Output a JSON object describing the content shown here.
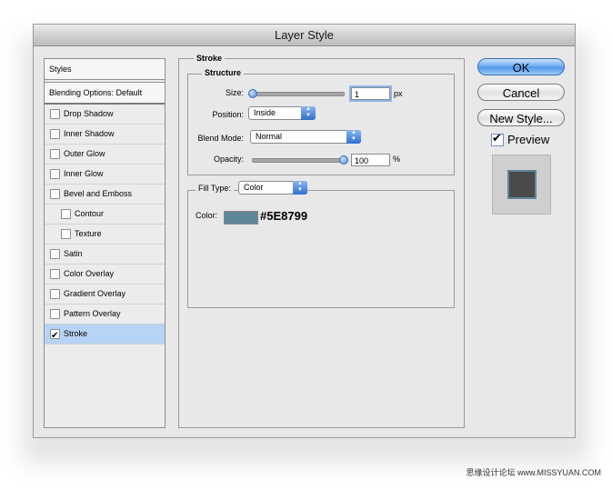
{
  "window": {
    "title": "Layer Style"
  },
  "left_panel": {
    "styles_header": "Styles",
    "blending_options": "Blending Options: Default",
    "items": [
      {
        "label": "Drop Shadow",
        "checked": false,
        "sub": false
      },
      {
        "label": "Inner Shadow",
        "checked": false,
        "sub": false
      },
      {
        "label": "Outer Glow",
        "checked": false,
        "sub": false
      },
      {
        "label": "Inner Glow",
        "checked": false,
        "sub": false
      },
      {
        "label": "Bevel and Emboss",
        "checked": false,
        "sub": false
      },
      {
        "label": "Contour",
        "checked": false,
        "sub": true
      },
      {
        "label": "Texture",
        "checked": false,
        "sub": true
      },
      {
        "label": "Satin",
        "checked": false,
        "sub": false
      },
      {
        "label": "Color Overlay",
        "checked": false,
        "sub": false
      },
      {
        "label": "Gradient Overlay",
        "checked": false,
        "sub": false
      },
      {
        "label": "Pattern Overlay",
        "checked": false,
        "sub": false
      },
      {
        "label": "Stroke",
        "checked": true,
        "sub": false,
        "selected": true
      }
    ]
  },
  "stroke": {
    "heading": "Stroke",
    "structure": {
      "heading": "Structure",
      "size_label": "Size:",
      "size_value": "1",
      "size_unit": "px",
      "size_slider_fraction": 0.0,
      "position_label": "Position:",
      "position_value": "Inside",
      "blend_label": "Blend Mode:",
      "blend_value": "Normal",
      "opacity_label": "Opacity:",
      "opacity_value": "100",
      "opacity_unit": "%",
      "opacity_slider_fraction": 1.0
    },
    "fill": {
      "type_label": "Fill Type:",
      "type_value": "Color",
      "color_label": "Color:",
      "color_hex": "#5E8799",
      "color_swatch": "#5e8799"
    }
  },
  "buttons": {
    "ok": "OK",
    "cancel": "Cancel",
    "new_style": "New Style..."
  },
  "preview": {
    "label": "Preview",
    "checked": true
  },
  "watermark": "思缘设计论坛 www.MISSYUAN.COM"
}
